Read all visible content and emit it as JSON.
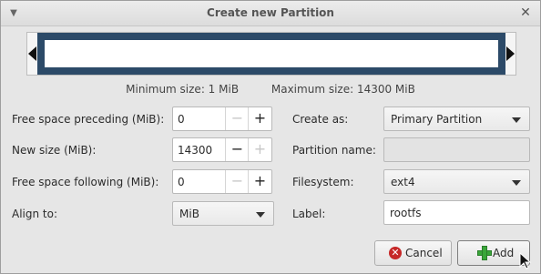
{
  "window": {
    "title": "Create new Partition"
  },
  "sizes": {
    "minimum": "Minimum size: 1 MiB",
    "maximum": "Maximum size: 14300 MiB"
  },
  "left": {
    "free_preceding": {
      "label": "Free space preceding (MiB):",
      "value": "0"
    },
    "new_size": {
      "label": "New size (MiB):",
      "value": "14300"
    },
    "free_following": {
      "label": "Free space following (MiB):",
      "value": "0"
    },
    "align": {
      "label": "Align to:",
      "value": "MiB"
    }
  },
  "right": {
    "create_as": {
      "label": "Create as:",
      "value": "Primary Partition"
    },
    "partition_name": {
      "label": "Partition name:",
      "value": ""
    },
    "filesystem": {
      "label": "Filesystem:",
      "value": "ext4"
    },
    "fs_label": {
      "label": "Label:",
      "value": "rootfs"
    }
  },
  "buttons": {
    "cancel": "Cancel",
    "add": "Add"
  },
  "spin_glyphs": {
    "minus": "−",
    "plus": "+"
  },
  "colors": {
    "partition_bar": "#2c4a68",
    "cancel_icon": "#c62828",
    "add_icon": "#3aa63a"
  }
}
